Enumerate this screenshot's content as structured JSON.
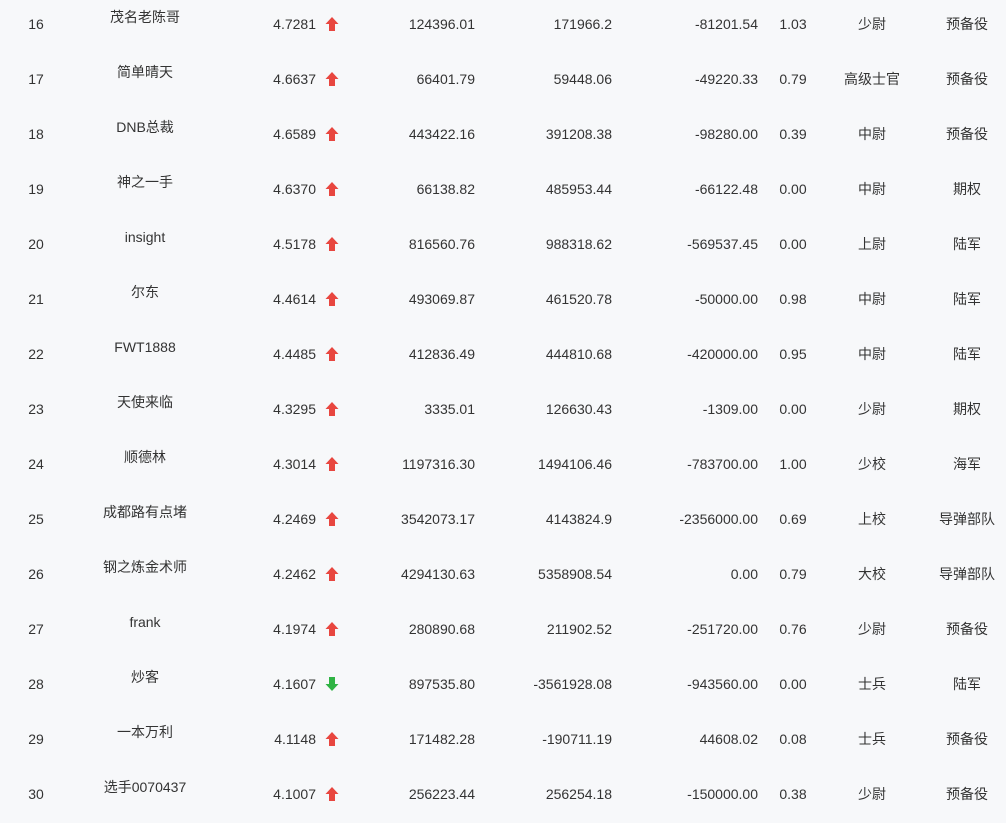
{
  "colors": {
    "up": "#e8463f",
    "down": "#2fb344",
    "text": "#333333",
    "background": "#f7f8fa"
  },
  "rows": [
    {
      "rank": "16",
      "name": "茂名老陈哥",
      "score": "4.7281",
      "trend": "up",
      "trend_icon": "red-up-arrow-icon",
      "v1": "124396.01",
      "v2": "171966.2",
      "v3": "-81201.54",
      "ratio": "1.03",
      "military_rank": "少尉",
      "branch": "预备役"
    },
    {
      "rank": "17",
      "name": "简单晴天",
      "score": "4.6637",
      "trend": "up",
      "trend_icon": "red-up-arrow-icon",
      "v1": "66401.79",
      "v2": "59448.06",
      "v3": "-49220.33",
      "ratio": "0.79",
      "military_rank": "高级士官",
      "branch": "预备役"
    },
    {
      "rank": "18",
      "name": "DNB总裁",
      "score": "4.6589",
      "trend": "up",
      "trend_icon": "red-up-arrow-icon",
      "v1": "443422.16",
      "v2": "391208.38",
      "v3": "-98280.00",
      "ratio": "0.39",
      "military_rank": "中尉",
      "branch": "预备役"
    },
    {
      "rank": "19",
      "name": "神之一手",
      "score": "4.6370",
      "trend": "up",
      "trend_icon": "red-up-arrow-icon",
      "v1": "66138.82",
      "v2": "485953.44",
      "v3": "-66122.48",
      "ratio": "0.00",
      "military_rank": "中尉",
      "branch": "期权"
    },
    {
      "rank": "20",
      "name": "insight",
      "score": "4.5178",
      "trend": "up",
      "trend_icon": "red-up-arrow-icon",
      "v1": "816560.76",
      "v2": "988318.62",
      "v3": "-569537.45",
      "ratio": "0.00",
      "military_rank": "上尉",
      "branch": "陆军"
    },
    {
      "rank": "21",
      "name": "尔东",
      "score": "4.4614",
      "trend": "up",
      "trend_icon": "red-up-arrow-icon",
      "v1": "493069.87",
      "v2": "461520.78",
      "v3": "-50000.00",
      "ratio": "0.98",
      "military_rank": "中尉",
      "branch": "陆军"
    },
    {
      "rank": "22",
      "name": "FWT1888",
      "score": "4.4485",
      "trend": "up",
      "trend_icon": "red-up-arrow-icon",
      "v1": "412836.49",
      "v2": "444810.68",
      "v3": "-420000.00",
      "ratio": "0.95",
      "military_rank": "中尉",
      "branch": "陆军"
    },
    {
      "rank": "23",
      "name": "天使来临",
      "score": "4.3295",
      "trend": "up",
      "trend_icon": "red-up-arrow-icon",
      "v1": "3335.01",
      "v2": "126630.43",
      "v3": "-1309.00",
      "ratio": "0.00",
      "military_rank": "少尉",
      "branch": "期权"
    },
    {
      "rank": "24",
      "name": "顺德林",
      "score": "4.3014",
      "trend": "up",
      "trend_icon": "red-up-arrow-icon",
      "v1": "1197316.30",
      "v2": "1494106.46",
      "v3": "-783700.00",
      "ratio": "1.00",
      "military_rank": "少校",
      "branch": "海军"
    },
    {
      "rank": "25",
      "name": "成都路有点堵",
      "score": "4.2469",
      "trend": "up",
      "trend_icon": "red-up-arrow-icon",
      "v1": "3542073.17",
      "v2": "4143824.9",
      "v3": "-2356000.00",
      "ratio": "0.69",
      "military_rank": "上校",
      "branch": "导弹部队"
    },
    {
      "rank": "26",
      "name": "钢之炼金术师",
      "score": "4.2462",
      "trend": "up",
      "trend_icon": "red-up-arrow-icon",
      "v1": "4294130.63",
      "v2": "5358908.54",
      "v3": "0.00",
      "ratio": "0.79",
      "military_rank": "大校",
      "branch": "导弹部队"
    },
    {
      "rank": "27",
      "name": "frank",
      "score": "4.1974",
      "trend": "up",
      "trend_icon": "red-up-arrow-icon",
      "v1": "280890.68",
      "v2": "211902.52",
      "v3": "-251720.00",
      "ratio": "0.76",
      "military_rank": "少尉",
      "branch": "预备役"
    },
    {
      "rank": "28",
      "name": "炒客",
      "score": "4.1607",
      "trend": "down",
      "trend_icon": "green-down-arrow-icon",
      "v1": "897535.80",
      "v2": "-3561928.08",
      "v3": "-943560.00",
      "ratio": "0.00",
      "military_rank": "士兵",
      "branch": "陆军"
    },
    {
      "rank": "29",
      "name": "一本万利",
      "score": "4.1148",
      "trend": "up",
      "trend_icon": "red-up-arrow-icon",
      "v1": "171482.28",
      "v2": "-190711.19",
      "v3": "44608.02",
      "ratio": "0.08",
      "military_rank": "士兵",
      "branch": "预备役"
    },
    {
      "rank": "30",
      "name": "选手0070437",
      "score": "4.1007",
      "trend": "up",
      "trend_icon": "red-up-arrow-icon",
      "v1": "256223.44",
      "v2": "256254.18",
      "v3": "-150000.00",
      "ratio": "0.38",
      "military_rank": "少尉",
      "branch": "预备役"
    }
  ]
}
